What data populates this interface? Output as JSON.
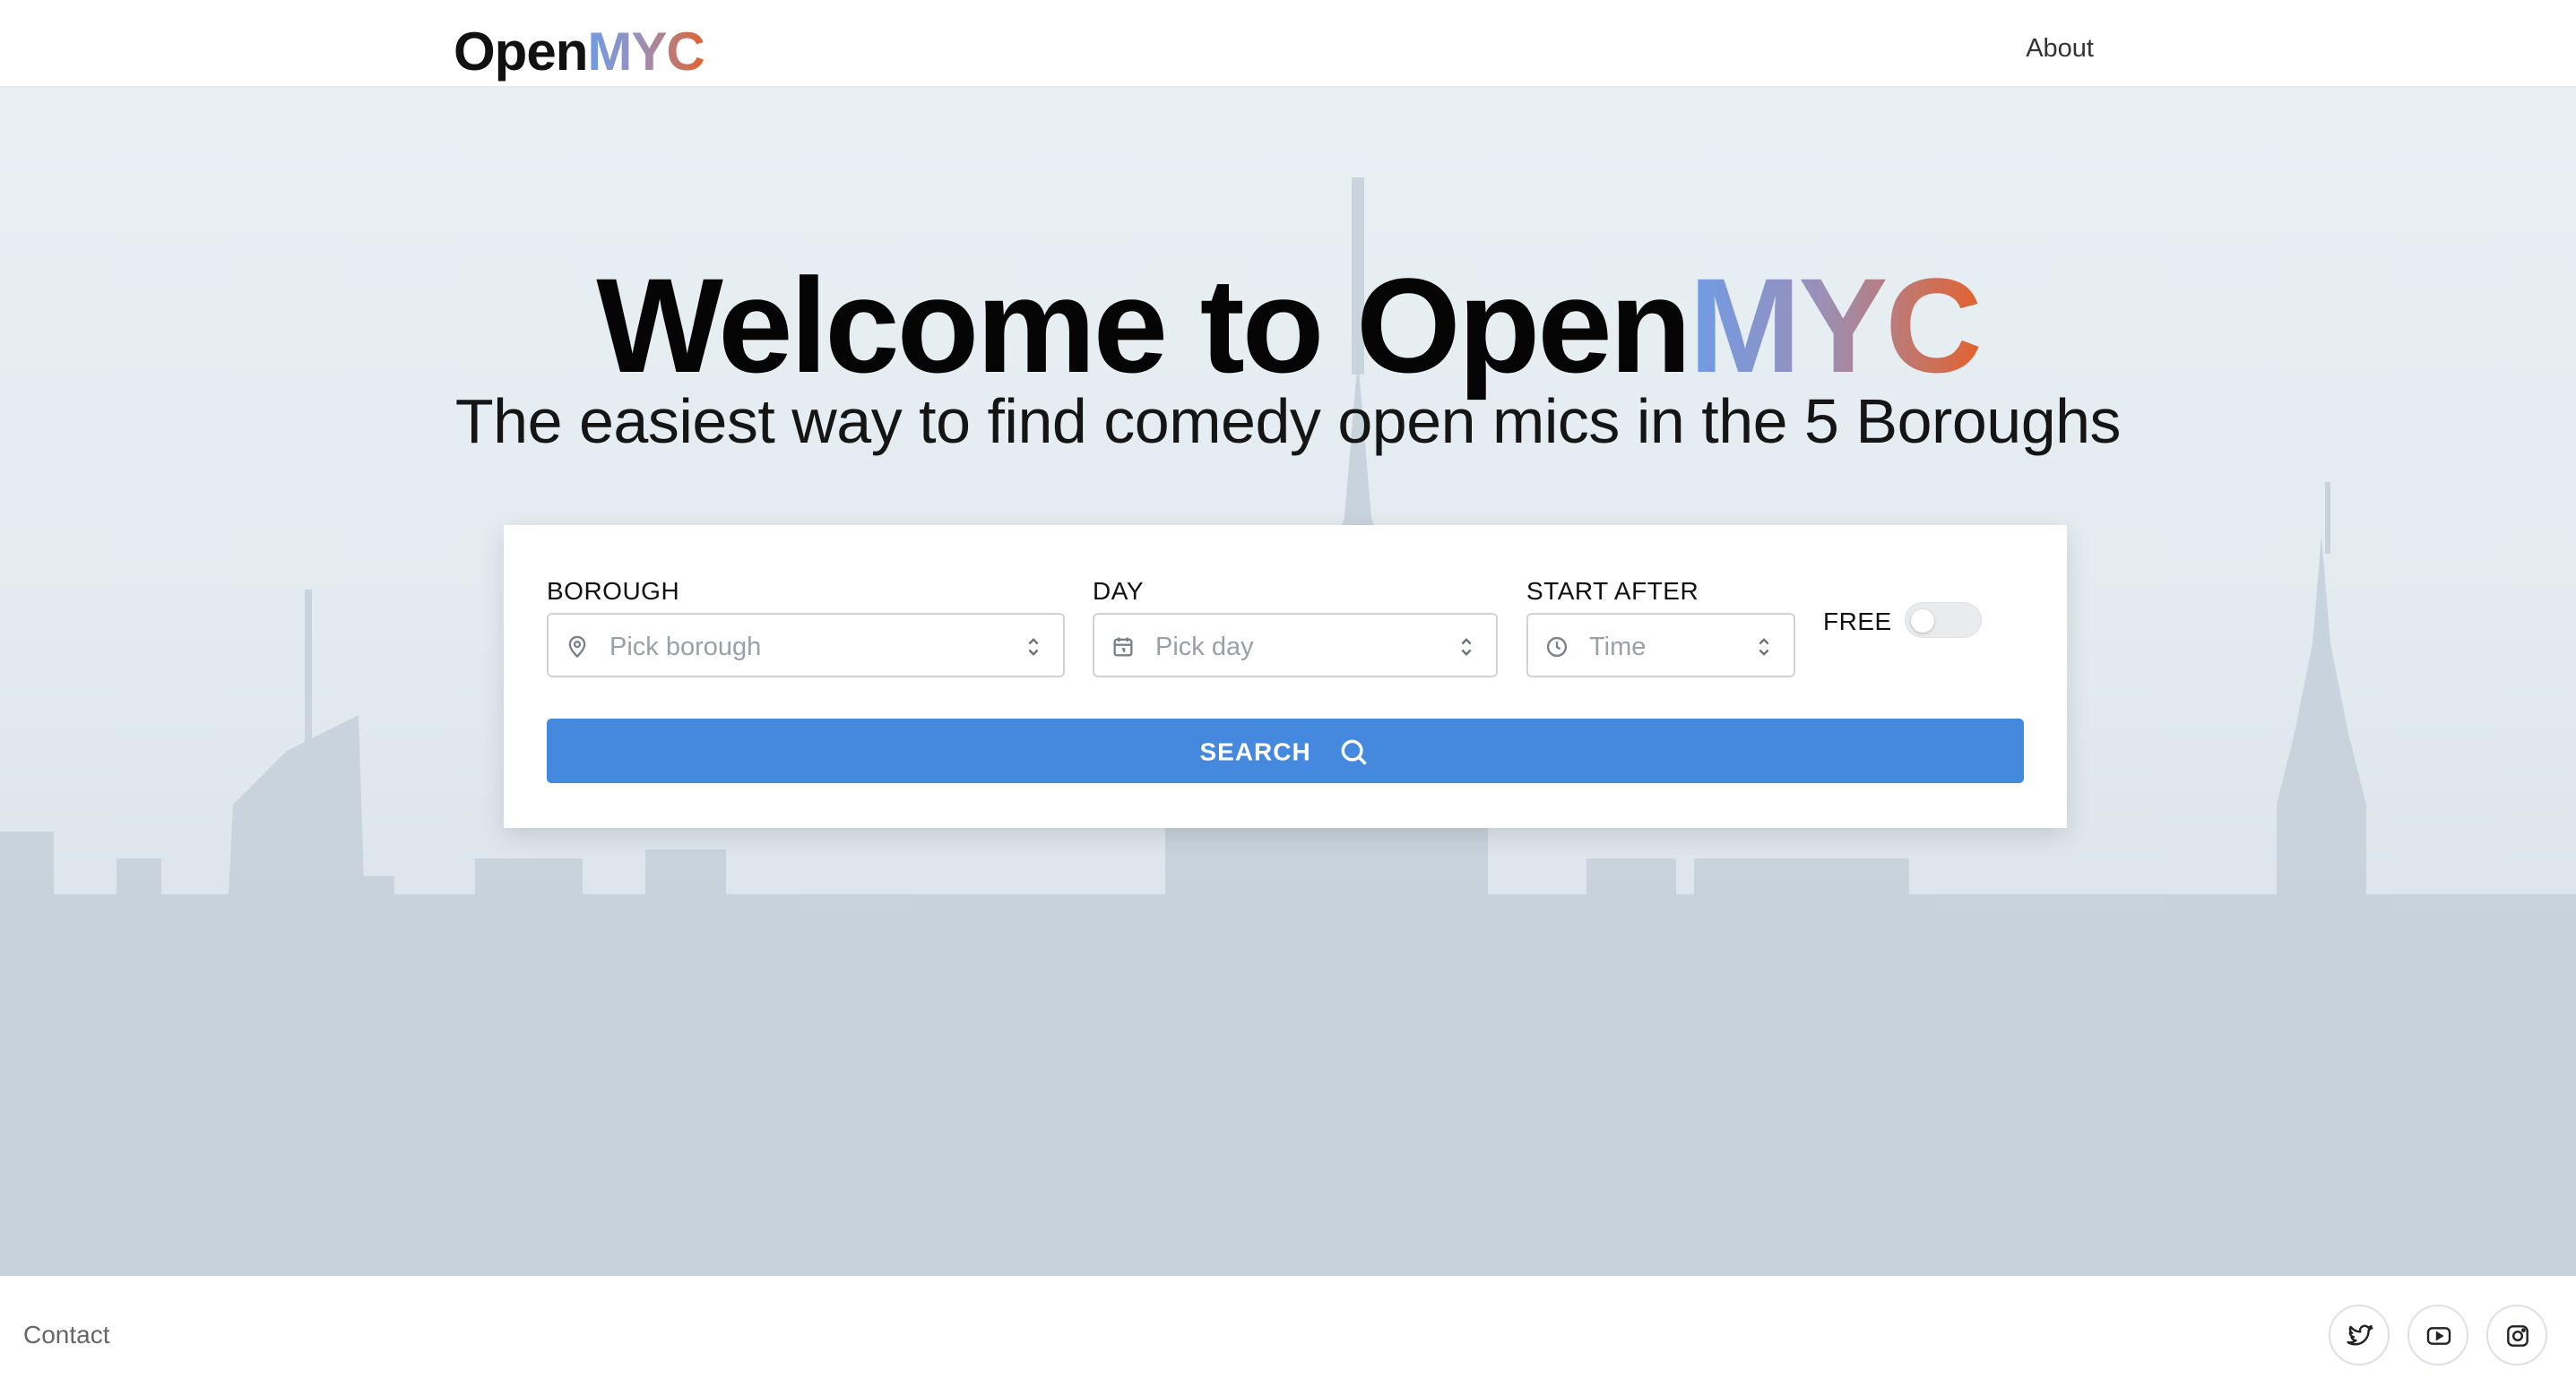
{
  "header": {
    "logo_plain": "Open",
    "logo_accent": "MYC",
    "about_label": "About"
  },
  "hero": {
    "title_plain": "Welcome to Open",
    "title_accent": "MYC",
    "subtitle": "The easiest way to find comedy open mics in the 5 Boroughs"
  },
  "search": {
    "borough": {
      "label": "BOROUGH",
      "placeholder": "Pick borough",
      "icon": "map-pin-icon"
    },
    "day": {
      "label": "DAY",
      "placeholder": "Pick day",
      "icon": "calendar-icon"
    },
    "start_after": {
      "label": "START AFTER",
      "placeholder": "Time",
      "icon": "clock-icon"
    },
    "free": {
      "label": "FREE",
      "enabled": false
    },
    "button_label": "SEARCH",
    "button_icon": "search-icon"
  },
  "footer": {
    "contact_label": "Contact",
    "social": [
      "twitter-icon",
      "youtube-icon",
      "instagram-icon"
    ]
  },
  "colors": {
    "accent_blue": "#4489de",
    "logo_gradient_start": "#6f9be6",
    "logo_gradient_end": "#e2622f"
  }
}
